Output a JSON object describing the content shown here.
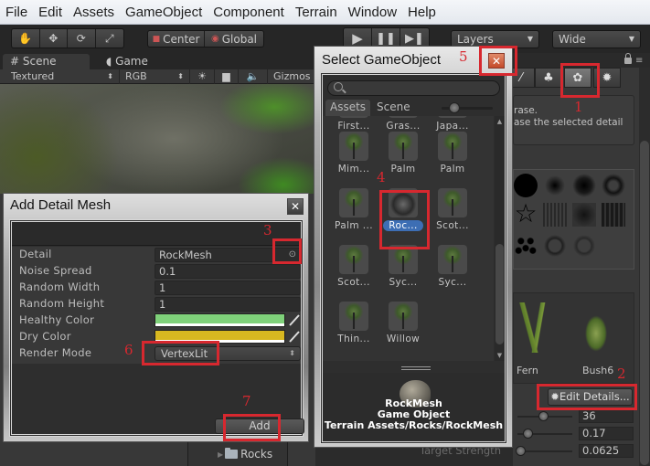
{
  "menubar": {
    "items": [
      "File",
      "Edit",
      "Assets",
      "GameObject",
      "Component",
      "Terrain",
      "Window",
      "Help"
    ]
  },
  "toolbar": {
    "transform_tools": [
      "hand-icon",
      "move-icon",
      "rotate-icon",
      "scale-icon"
    ],
    "pivot_center": "Center",
    "pivot_global": "Global",
    "play_controls": [
      "play-icon",
      "pause-icon",
      "step-icon"
    ],
    "layers_label": "Layers",
    "layout_label": "Wide"
  },
  "scene": {
    "tabs": [
      {
        "label": "Scene",
        "icon": "hash-icon",
        "active": true
      },
      {
        "label": "Game",
        "icon": "pacman-icon",
        "active": false
      }
    ],
    "render_mode": "Textured",
    "color_mode": "RGB",
    "gizmos_label": "Gizmos"
  },
  "add_detail_mesh": {
    "title": "Add Detail Mesh",
    "fields": [
      {
        "label": "Detail",
        "value": "RockMesh"
      },
      {
        "label": "Noise Spread",
        "value": "0.1"
      },
      {
        "label": "Random Width",
        "value": "1"
      },
      {
        "label": "Random Height",
        "value": "1"
      },
      {
        "label": "Healthy Color",
        "color": "#7fd17a"
      },
      {
        "label": "Dry Color",
        "color": "#d8b820"
      },
      {
        "label": "Render Mode",
        "value": "VertexLit"
      }
    ],
    "add_label": "Add"
  },
  "select_gameobject": {
    "title": "Select GameObject",
    "search_placeholder": "",
    "tabs": [
      "Assets",
      "Scene"
    ],
    "active_tab": "Assets",
    "assets": [
      {
        "name": "First..."
      },
      {
        "name": "Gras..."
      },
      {
        "name": "Japa..."
      },
      {
        "name": "Mim..."
      },
      {
        "name": "Palm"
      },
      {
        "name": "Palm"
      },
      {
        "name": "Palm ..."
      },
      {
        "name": "Roc...",
        "selected": true
      },
      {
        "name": "Scot..."
      },
      {
        "name": "Scot..."
      },
      {
        "name": "Syc..."
      },
      {
        "name": "Syc..."
      },
      {
        "name": "Thin..."
      },
      {
        "name": "Willow"
      }
    ],
    "preview": {
      "name": "RockMesh",
      "type": "Game Object",
      "path": "Terrain Assets/Rocks/RockMesh"
    }
  },
  "inspector": {
    "tool_tabs": [
      "paint-brush-icon",
      "trees-icon",
      "details-icon",
      "settings-gear-icon"
    ],
    "active_tool": "details-icon",
    "help_line1": "rase.",
    "help_line2": "ase the selected detail",
    "details": [
      "Fern",
      "Bush6"
    ],
    "edit_details_label": "Edit Details...",
    "brush_size": "36",
    "opacity": "0.17",
    "target_strength": "0.0625",
    "target_strength_label": "Target Strength"
  },
  "project": {
    "folder": "Rocks"
  },
  "annotations": [
    "1",
    "2",
    "3",
    "4",
    "5",
    "6",
    "7"
  ]
}
